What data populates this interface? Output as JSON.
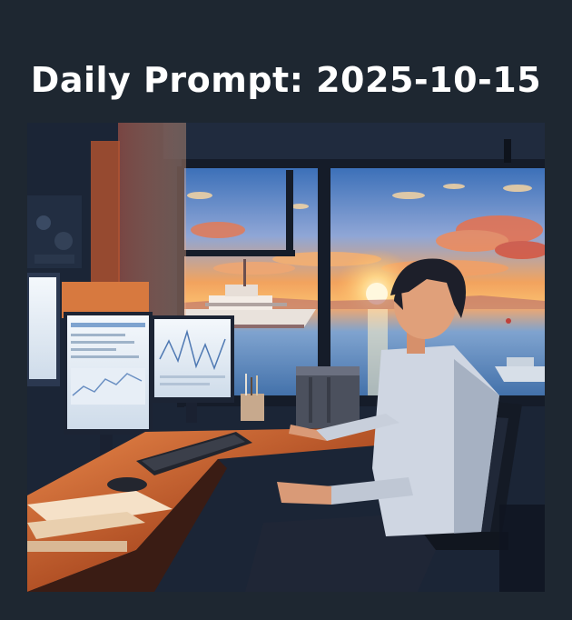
{
  "header": {
    "title": "Daily Prompt: 2025-10-15"
  },
  "artwork": {
    "description_icon": "illustration",
    "colors": {
      "sky_top": "#3a6fb8",
      "sky_mid": "#f2a35e",
      "sun": "#ffe9a8",
      "sea": "#5a8fc4",
      "interior": "#1a2436",
      "desk": "#c4602c",
      "monitor_glow": "#dfe9f5"
    }
  }
}
